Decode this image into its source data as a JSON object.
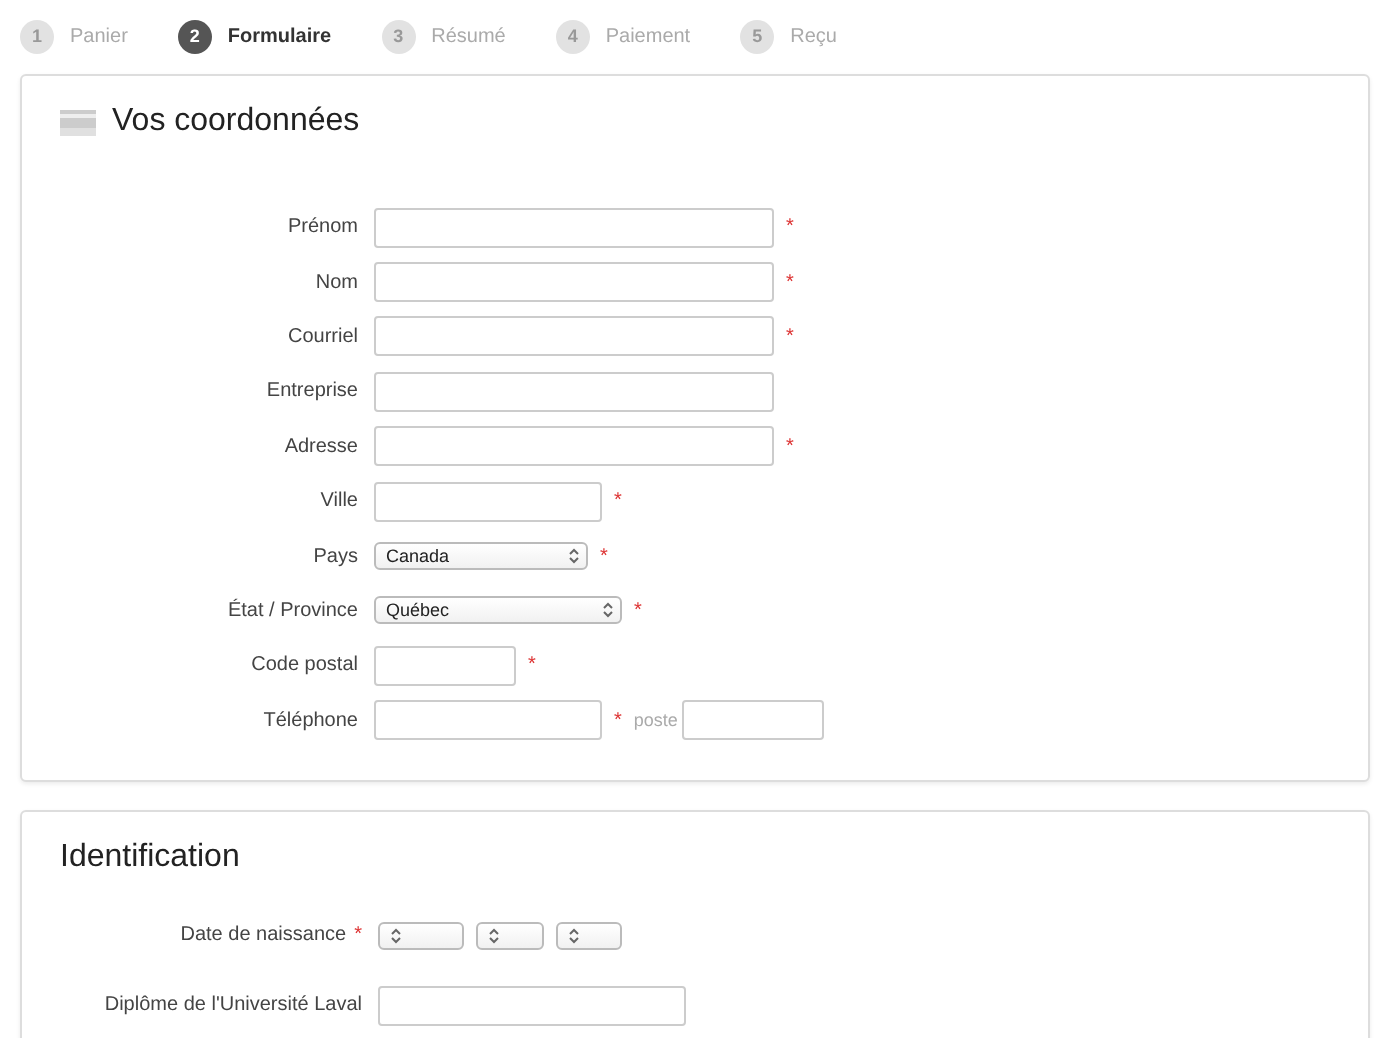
{
  "steps": [
    {
      "number": "1",
      "label": "Panier",
      "selected": false
    },
    {
      "number": "2",
      "label": "Formulaire",
      "selected": true
    },
    {
      "number": "3",
      "label": "Résumé",
      "selected": false
    },
    {
      "number": "4",
      "label": "Paiement",
      "selected": false
    },
    {
      "number": "5",
      "label": "Reçu",
      "selected": false
    }
  ],
  "contact": {
    "title": "Vos coordonnées",
    "fields": [
      {
        "kind": "text",
        "label": "Prénom",
        "required_mark": "*"
      },
      {
        "kind": "text",
        "label": "Nom",
        "required_mark": "*"
      },
      {
        "kind": "text",
        "label": "Courriel",
        "required_mark": "*"
      },
      {
        "kind": "text",
        "label": "Entreprise"
      },
      {
        "kind": "text",
        "label": "Adresse",
        "required_mark": "*"
      },
      {
        "kind": "text",
        "label": "Ville",
        "required_mark": "*"
      },
      {
        "kind": "select",
        "label": "Pays",
        "value": "Canada",
        "required_mark": "*"
      },
      {
        "kind": "select",
        "label": "État / Province",
        "value": "Québec",
        "required_mark": "*"
      },
      {
        "kind": "text",
        "label": "Code postal",
        "required_mark": "*"
      },
      {
        "kind": "phone",
        "label": "Téléphone",
        "required_mark": "*",
        "extension_label": "poste"
      }
    ]
  },
  "identification": {
    "title": "Identification",
    "fields": [
      {
        "kind": "date",
        "label": "Date de naissance",
        "required_mark": "*"
      },
      {
        "kind": "text",
        "label": "Diplôme de l'Université Laval"
      }
    ]
  }
}
